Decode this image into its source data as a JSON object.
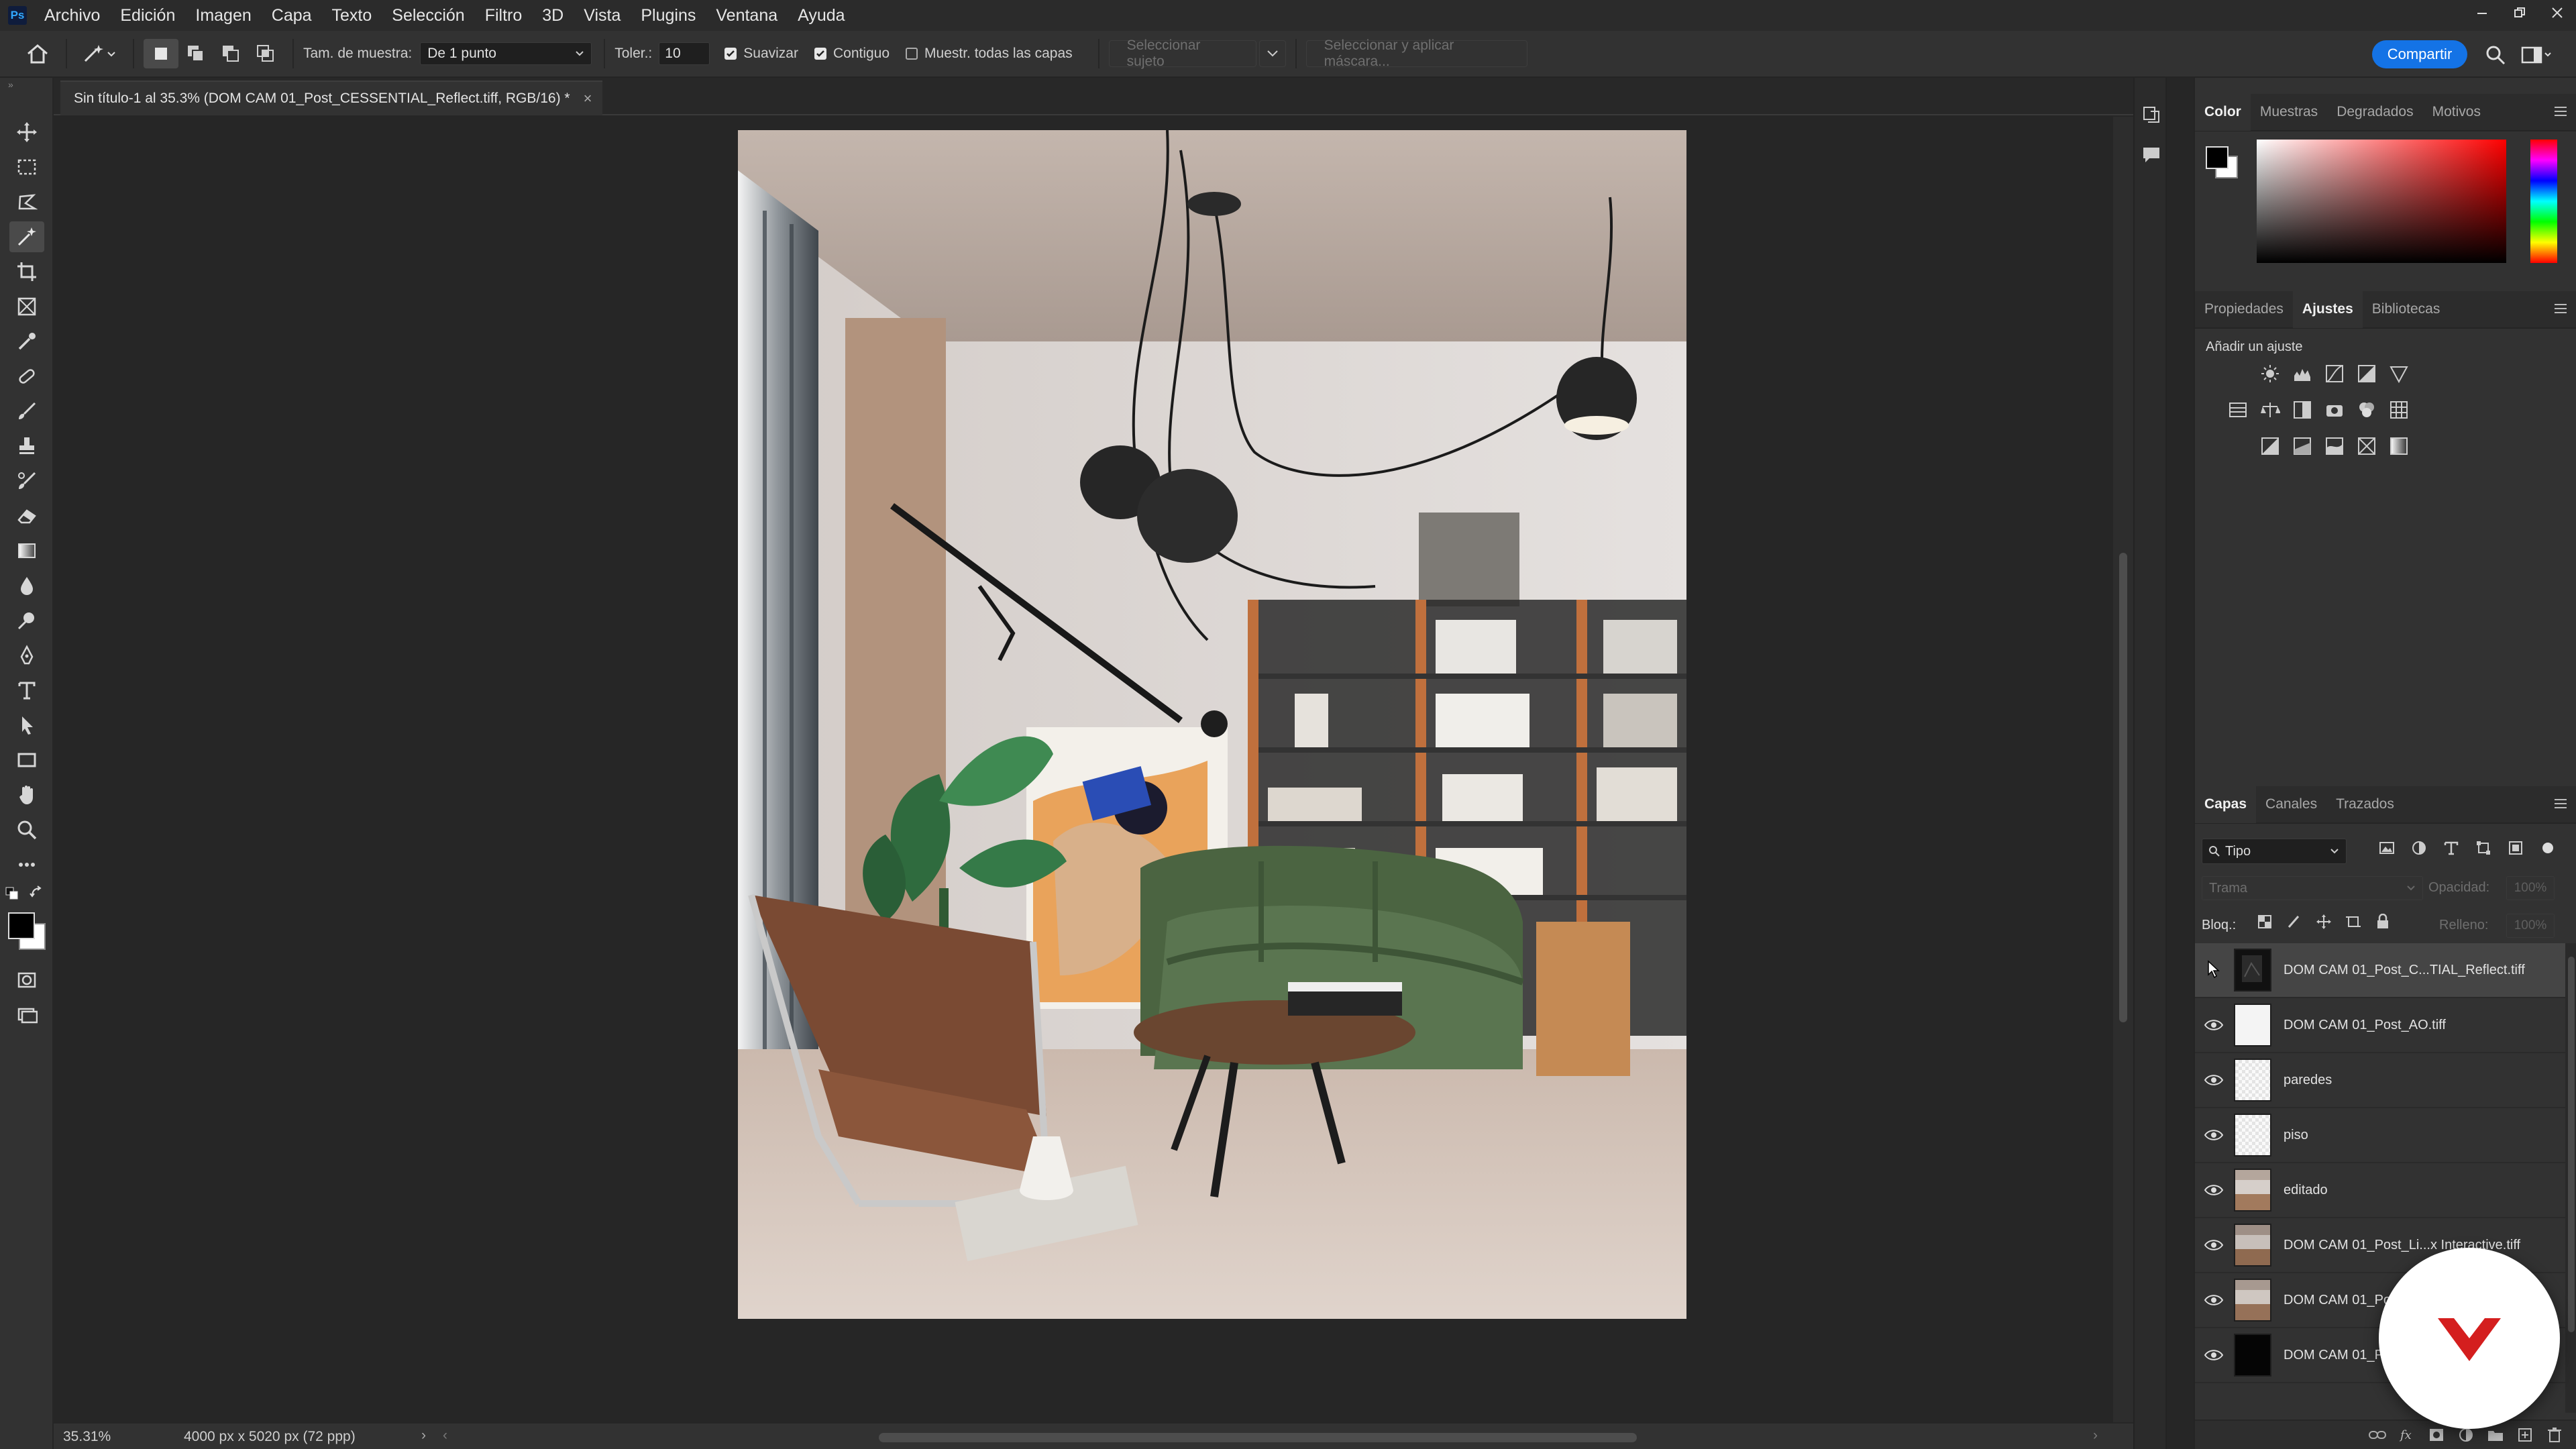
{
  "app": {
    "logo": "Ps",
    "colors": {
      "accent": "#1473e6",
      "panel": "#323232",
      "canvas": "#262626"
    }
  },
  "menubar": {
    "items": [
      "Archivo",
      "Edición",
      "Imagen",
      "Capa",
      "Texto",
      "Selección",
      "Filtro",
      "3D",
      "Vista",
      "Plugins",
      "Ventana",
      "Ayuda"
    ]
  },
  "options": {
    "sample_size_label": "Tam. de muestra:",
    "sample_size_value": "De 1 punto",
    "tolerance_label": "Toler.:",
    "tolerance_value": "10",
    "antialias_label": "Suavizar",
    "contiguous_label": "Contiguo",
    "sample_all_label": "Muestr. todas las capas",
    "select_subject_label": "Seleccionar sujeto",
    "select_mask_label": "Seleccionar y aplicar máscara...",
    "share_label": "Compartir"
  },
  "document": {
    "tab_title": "Sin título-1 al 35.3% (DOM CAM 01_Post_CESSENTIAL_Reflect.tiff, RGB/16) *",
    "close_glyph": "×",
    "zoom": "35.31%",
    "dimensions": "4000 px x 5020 px (72 ppp)"
  },
  "color_panel": {
    "tabs": [
      "Color",
      "Muestras",
      "Degradados",
      "Motivos"
    ],
    "active": "Color"
  },
  "properties_panel": {
    "tabs": [
      "Propiedades",
      "Ajustes",
      "Bibliotecas"
    ],
    "active": "Ajustes",
    "add_adjustment_label": "Añadir un ajuste"
  },
  "layers_panel": {
    "tabs": [
      "Capas",
      "Canales",
      "Trazados"
    ],
    "active": "Capas",
    "filter_label": "Tipo",
    "blend_mode": "Trama",
    "opacity_label": "Opacidad:",
    "opacity_value": "100%",
    "lock_label": "Bloq.:",
    "fill_label": "Relleno:",
    "fill_value": "100%",
    "layers": [
      {
        "name": "DOM CAM 01_Post_C...TIAL_Reflect.tiff",
        "thumb": "dark"
      },
      {
        "name": "DOM CAM 01_Post_AO.tiff",
        "thumb": "white"
      },
      {
        "name": "paredes",
        "thumb": "check"
      },
      {
        "name": "piso",
        "thumb": "check"
      },
      {
        "name": "editado",
        "thumb": "photo"
      },
      {
        "name": "DOM CAM 01_Post_Li...x Interactive.tiff",
        "thumb": "photo"
      },
      {
        "name": "DOM CAM 01_Po",
        "thumb": "photo"
      },
      {
        "name": "DOM CAM 01_Po",
        "thumb": "black"
      }
    ]
  },
  "tools": [
    "move-tool-icon",
    "marquee-tool-icon",
    "lasso-tool-icon",
    "magic-wand-tool-icon",
    "crop-tool-icon",
    "frame-tool-icon",
    "eyedropper-tool-icon",
    "healing-brush-icon",
    "brush-tool-icon",
    "stamp-tool-icon",
    "history-brush-icon",
    "eraser-tool-icon",
    "gradient-tool-icon",
    "blur-tool-icon",
    "dodge-tool-icon",
    "pen-tool-icon",
    "type-tool-icon",
    "path-selection-icon",
    "rectangle-tool-icon",
    "hand-tool-icon",
    "zoom-tool-icon",
    "more-tools-icon"
  ]
}
